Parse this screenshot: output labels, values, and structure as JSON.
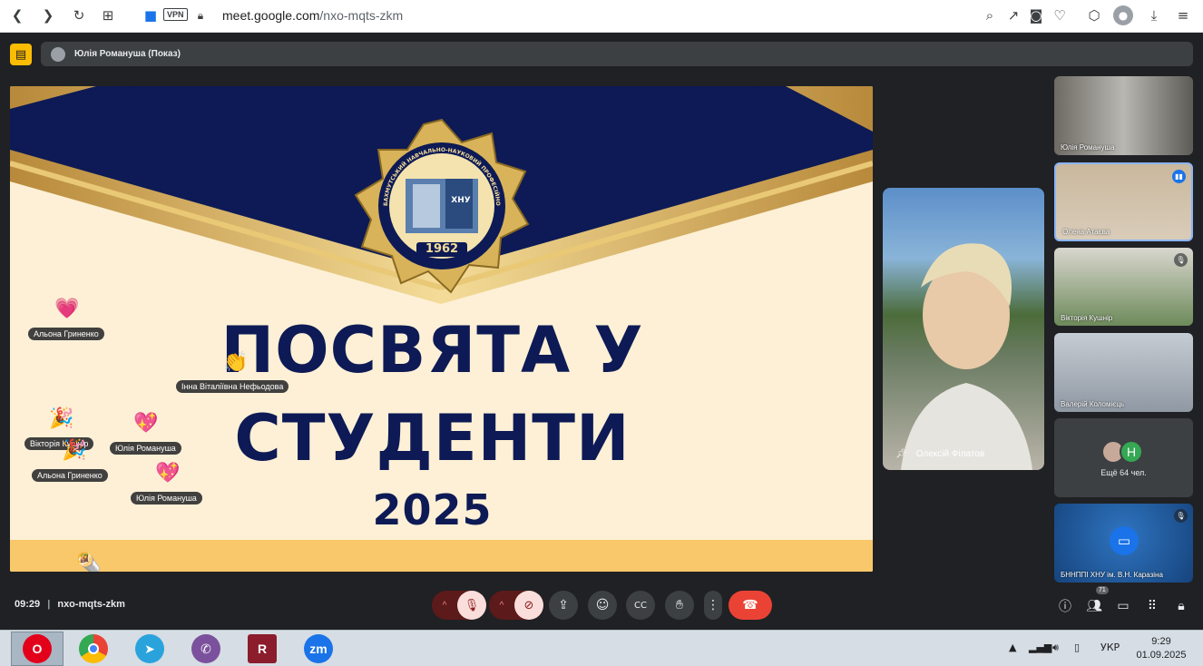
{
  "browser": {
    "url_host": "meet.google.com",
    "url_path": "/nxo-mqts-zkm",
    "vpn_label": "VPN"
  },
  "presenting": {
    "label": "Юлія Романуша (Показ)"
  },
  "slide": {
    "emblem_year": "1962",
    "emblem_letters": "ХНУ",
    "emblem_ring_text": "БАХМУТСЬКИЙ НАВЧАЛЬНО-НАУКОВИЙ ПРОФЕСІЙНО-ПЕДАГОГІЧНИЙ ІНСТИТУТ",
    "title_line1": "ПОСВЯТА У",
    "title_line2": "СТУДЕНТИ",
    "year": "2025"
  },
  "reactions": [
    {
      "emoji": "💗",
      "name": "Альона Гриненко"
    },
    {
      "emoji": "👏",
      "name": "Інна Віталіївна Нефьодова"
    },
    {
      "emoji": "🎉",
      "name": "Вікторія Кушнір"
    },
    {
      "emoji": "💖",
      "name": "Юлія Романуша"
    },
    {
      "emoji": "🎉",
      "name": "Альона Гриненко"
    },
    {
      "emoji": "💖",
      "name": "Юлія Романуша"
    },
    {
      "emoji": "🌯",
      "name": ""
    }
  ],
  "featured": {
    "name": "Олексій Філатов",
    "pin_icon": "pin-icon"
  },
  "tiles": [
    {
      "name": "Юлія Романуша",
      "mic": "none"
    },
    {
      "name": "Олена Атаєва",
      "mic": "speaking"
    },
    {
      "name": "Вікторія Кушнір",
      "mic": "muted"
    },
    {
      "name": "Валерій Коломієць",
      "mic": "none"
    },
    {
      "name": "Ещё 64 чел.",
      "avatar_letter": "H"
    },
    {
      "name": "БННППІ ХНУ ім. В.Н. Каразіна",
      "mic": "muted"
    }
  ],
  "bottom": {
    "time": "09:29",
    "meeting_code": "nxo-mqts-zkm",
    "participants_count": "71"
  },
  "taskbar": {
    "language": "УКР",
    "clock_time": "9:29",
    "clock_date": "01.09.2025",
    "apps": [
      "Opera",
      "Chrome",
      "Telegram",
      "Viber",
      "WinRAR",
      "Zoom"
    ]
  },
  "colors": {
    "meet_bg": "#202124",
    "slide_navy": "#0d1a55",
    "slide_gold": "#c9a24a",
    "end_call": "#ea4335",
    "present_badge": "#fbbc04"
  }
}
